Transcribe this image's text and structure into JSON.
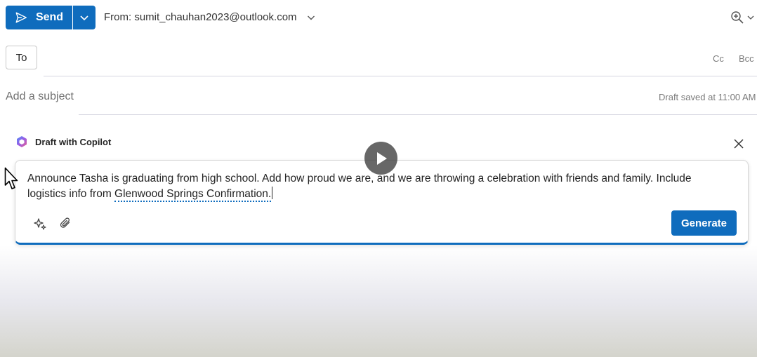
{
  "toolbar": {
    "send_label": "Send",
    "from_label": "From: sumit_chauhan2023@outlook.com"
  },
  "recipients": {
    "to_label": "To",
    "to_value": "",
    "cc_label": "Cc",
    "bcc_label": "Bcc"
  },
  "subject": {
    "placeholder": "Add a subject",
    "value": "",
    "draft_status": "Draft saved at 11:00 AM"
  },
  "copilot": {
    "title": "Draft with Copilot",
    "prompt_text": "Announce Tasha is graduating from high school. Add how proud we are, and we are throwing a celebration with friends and family. Include logistics info from ",
    "reference_link": "Glenwood Springs Confirmation.",
    "generate_label": "Generate"
  },
  "icons": {
    "send": "send-icon",
    "split": "chevron-down-icon",
    "from_dropdown": "chevron-down-icon",
    "zoom": "zoom-in-icon",
    "copilot_logo": "copilot-logo-icon",
    "close": "close-icon",
    "sparkle": "sparkle-icon",
    "attach": "paperclip-icon",
    "play": "play-icon",
    "cursor": "mouse-pointer-icon"
  },
  "colors": {
    "accent": "#0f6cbd",
    "text": "#242424",
    "muted": "#7a7a7a"
  }
}
